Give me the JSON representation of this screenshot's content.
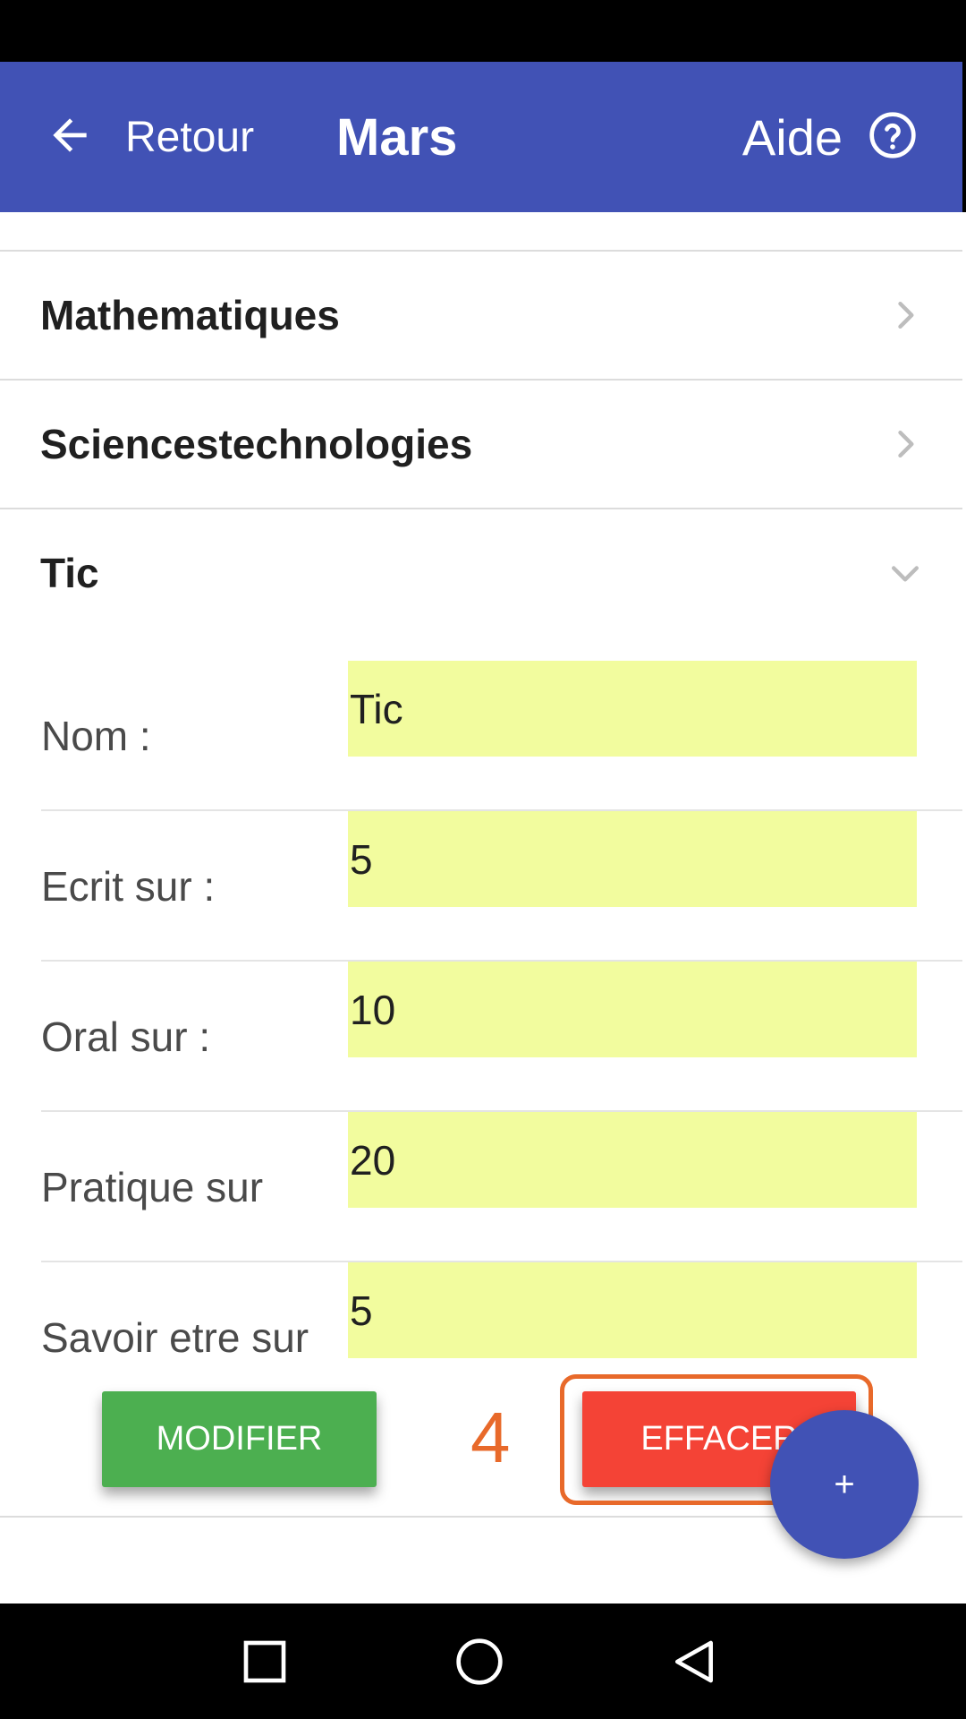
{
  "app_bar": {
    "back_label": "Retour",
    "title": "Mars",
    "help_label": "Aide"
  },
  "subjects": [
    {
      "label": "Mathematiques",
      "expanded": false
    },
    {
      "label": "Sciencestechnologies",
      "expanded": false
    },
    {
      "label": "Tic",
      "expanded": true
    }
  ],
  "form": {
    "fields": [
      {
        "label": "Nom :",
        "value": "Tic"
      },
      {
        "label": "Ecrit sur :",
        "value": "5"
      },
      {
        "label": "Oral sur :",
        "value": "10"
      },
      {
        "label": "Pratique sur",
        "value": "20"
      },
      {
        "label": "Savoir etre sur",
        "value": "5"
      }
    ],
    "modify_label": "MODIFIER",
    "delete_label": "EFFACER"
  },
  "annotation": {
    "step_number": "4"
  },
  "fab": {
    "label": "+"
  },
  "colors": {
    "primary": "#4152b5",
    "field_bg": "#f2fc9e",
    "modify": "#4caf50",
    "delete": "#f44336",
    "annotation": "#e8692a"
  },
  "icons": {
    "back": "arrow-left-icon",
    "help": "help-circle-icon",
    "collapsed": "chevron-right-icon",
    "expanded": "chevron-down-icon",
    "nav_recents": "square-icon",
    "nav_home": "circle-icon",
    "nav_back": "triangle-back-icon"
  }
}
